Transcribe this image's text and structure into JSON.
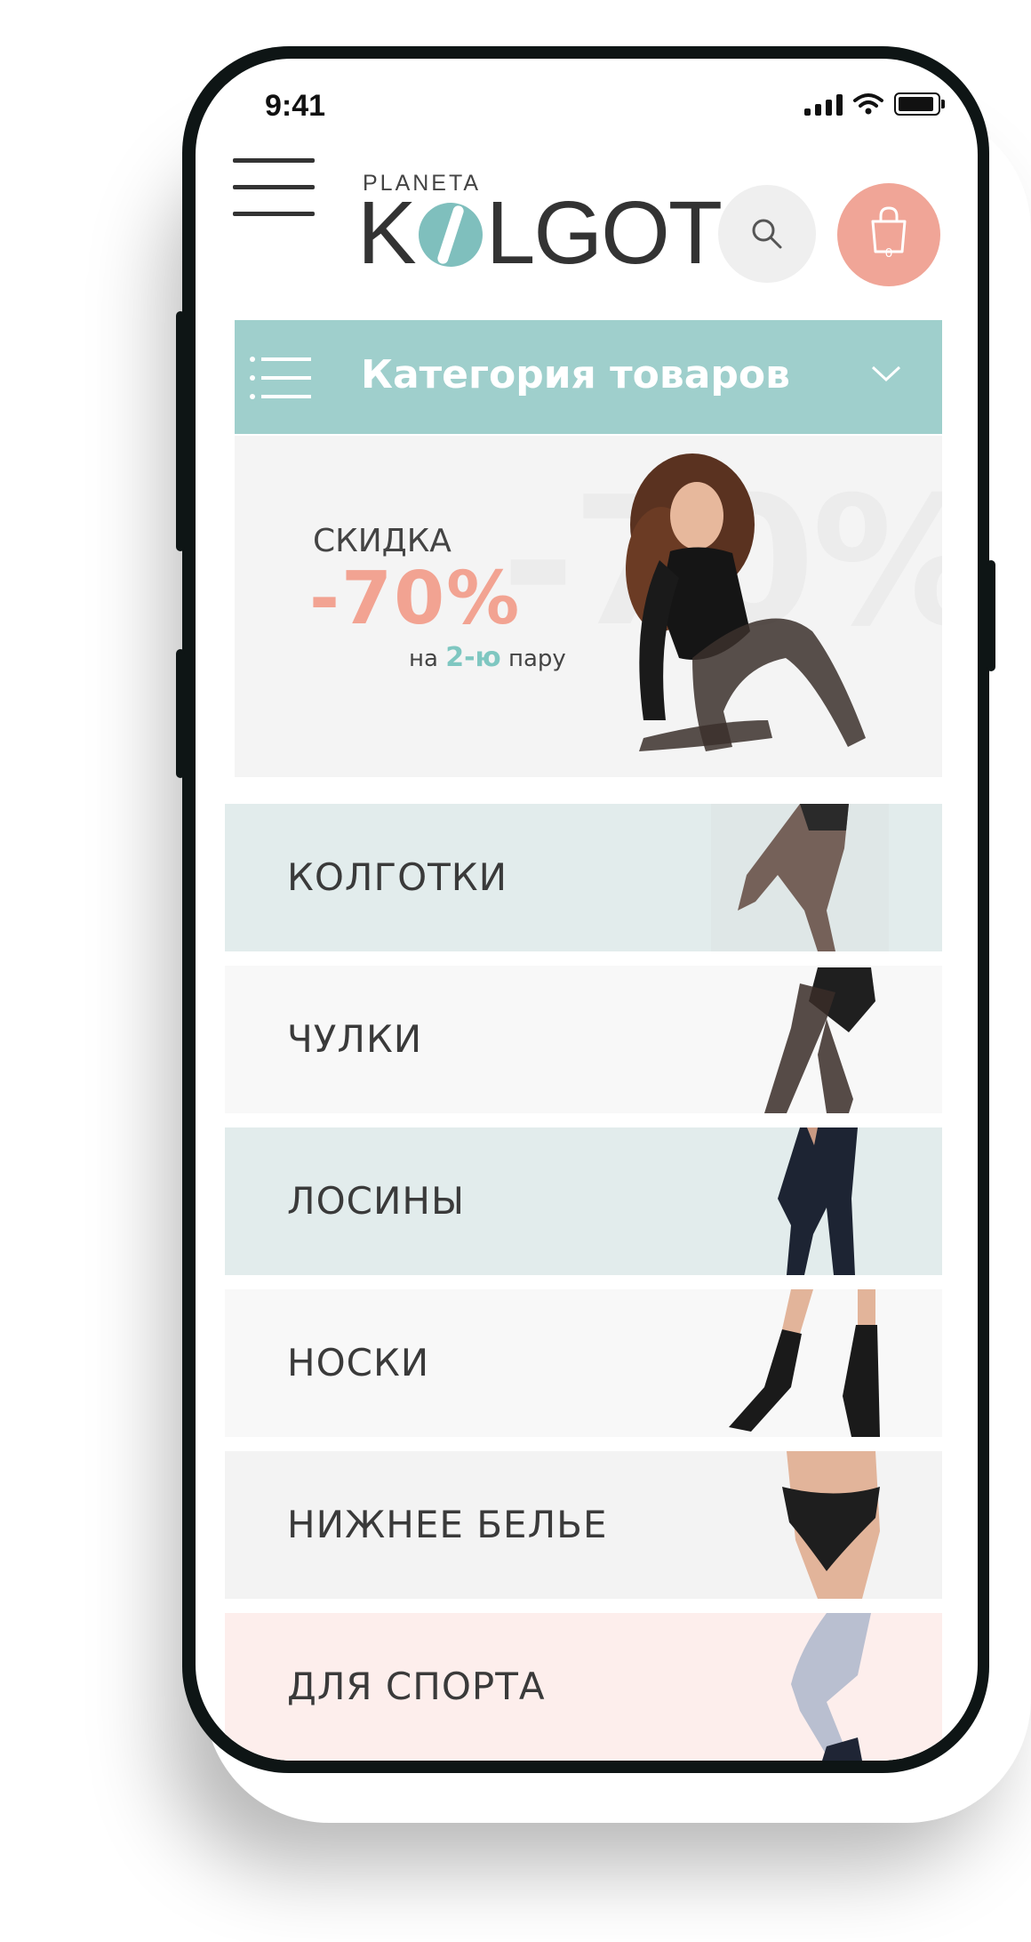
{
  "status_bar": {
    "time": "9:41"
  },
  "header": {
    "logo_top": "PLANETA",
    "logo_left": "K",
    "logo_right": "LGOT",
    "cart_count": "0"
  },
  "category_bar": {
    "label": "Категория товаров"
  },
  "promo": {
    "bg_text": "-70%",
    "small": "СКИДКА",
    "big": "-70%",
    "note_pre": "на",
    "note_accent": "2-ю",
    "note_post": "пару"
  },
  "categories": [
    {
      "label": "КОЛГОТКИ",
      "bg": "#e2ecec"
    },
    {
      "label": "ЧУЛКИ",
      "bg": "#f8f8f8"
    },
    {
      "label": "ЛОСИНЫ",
      "bg": "#e2ecec"
    },
    {
      "label": "НОСКИ",
      "bg": "#f8f8f8"
    },
    {
      "label": "НИЖНЕЕ БЕЛЬЕ",
      "bg": "#f3f3f3"
    },
    {
      "label": "ДЛЯ СПОРТА",
      "bg": "#fdeeec"
    }
  ],
  "colors": {
    "accent_teal": "#9fcfcc",
    "accent_coral": "#f0a597"
  }
}
